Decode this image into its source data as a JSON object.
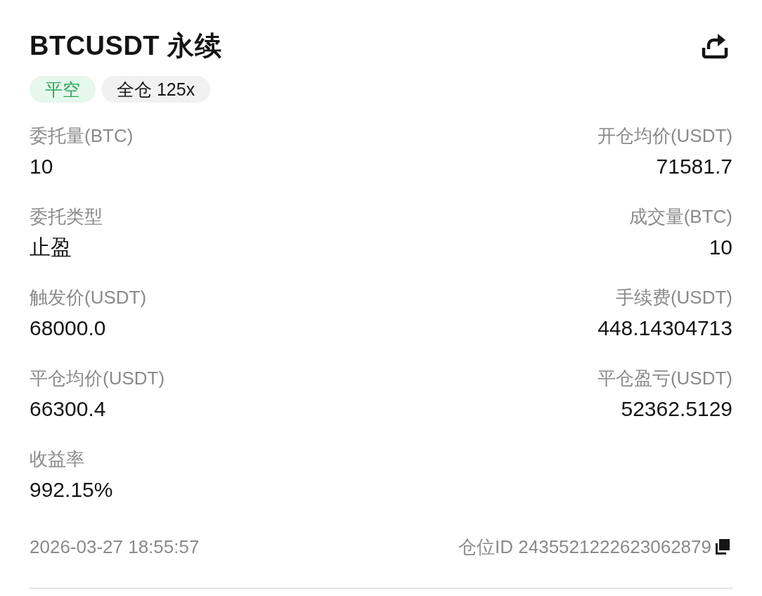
{
  "header": {
    "title": "BTCUSDT 永续",
    "tags": [
      {
        "label": "平空",
        "kind": "side"
      },
      {
        "label": "全仓 125x",
        "kind": "margin"
      }
    ]
  },
  "rows": [
    {
      "left": {
        "label": "委托量(BTC)",
        "value": "10"
      },
      "right": {
        "label": "开仓均价(USDT)",
        "value": "71581.7"
      }
    },
    {
      "left": {
        "label": "委托类型",
        "value": "止盈"
      },
      "right": {
        "label": "成交量(BTC)",
        "value": "10"
      }
    },
    {
      "left": {
        "label": "触发价(USDT)",
        "value": "68000.0"
      },
      "right": {
        "label": "手续费(USDT)",
        "value": "448.14304713"
      }
    },
    {
      "left": {
        "label": "平仓均价(USDT)",
        "value": "66300.4"
      },
      "right": {
        "label": "平仓盈亏(USDT)",
        "value": "52362.5129"
      }
    },
    {
      "left": {
        "label": "收益率",
        "value": "992.15%"
      }
    }
  ],
  "footer": {
    "time": "2026-03-27 18:55:57",
    "position_id": "仓位ID 2435521222623062879"
  }
}
